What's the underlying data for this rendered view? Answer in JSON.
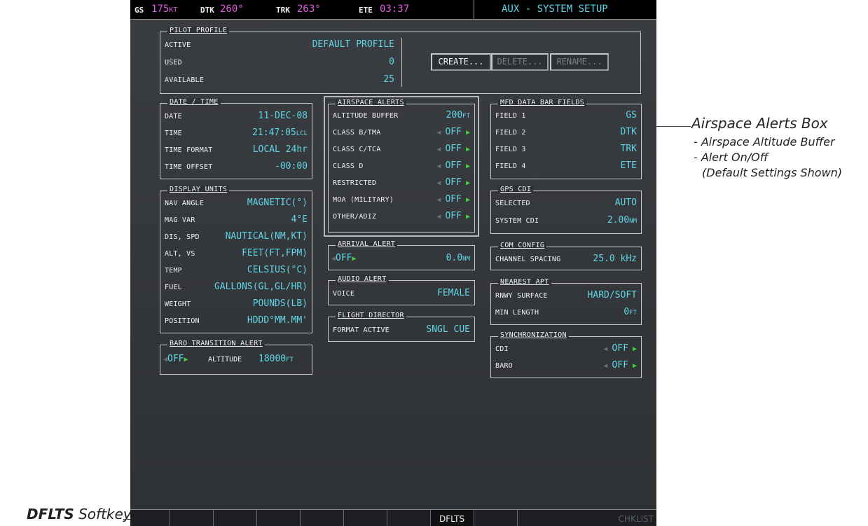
{
  "topbar": {
    "gs_label": "GS",
    "gs_value": "175",
    "gs_unit": "KT",
    "dtk_label": "DTK",
    "dtk_value": "260°",
    "trk_label": "TRK",
    "trk_value": "263°",
    "ete_label": "ETE",
    "ete_value": "03:37",
    "page_title": "AUX - SYSTEM SETUP"
  },
  "pilot_profile": {
    "title": "PILOT PROFILE",
    "active_label": "ACTIVE",
    "active_value": "DEFAULT PROFILE",
    "used_label": "USED",
    "used_value": "0",
    "available_label": "AVAILABLE",
    "available_value": "25",
    "create_label": "CREATE...",
    "delete_label": "DELETE...",
    "rename_label": "RENAME..."
  },
  "date_time": {
    "title": "DATE / TIME",
    "rows": [
      {
        "label": "DATE",
        "value": "11-DEC-08",
        "unit": ""
      },
      {
        "label": "TIME",
        "value": "21:47:05",
        "unit": "LCL"
      },
      {
        "label": "TIME FORMAT",
        "value": "LOCAL 24hr",
        "unit": ""
      },
      {
        "label": "TIME OFFSET",
        "value": "-00:00",
        "unit": ""
      }
    ]
  },
  "display_units": {
    "title": "DISPLAY UNITS",
    "rows": [
      {
        "label": "NAV ANGLE",
        "value": "MAGNETIC(°)"
      },
      {
        "label": "MAG VAR",
        "value": "4°E"
      },
      {
        "label": "DIS, SPD",
        "value": "NAUTICAL(NM,KT)"
      },
      {
        "label": "ALT, VS",
        "value": "FEET(FT,FPM)"
      },
      {
        "label": "TEMP",
        "value": "CELSIUS(°C)"
      },
      {
        "label": "FUEL",
        "value": "GALLONS(GL,GL/HR)"
      },
      {
        "label": "WEIGHT",
        "value": "POUNDS(LB)"
      },
      {
        "label": "POSITION",
        "value": "HDDD°MM.MM'"
      }
    ]
  },
  "baro_alert": {
    "title": "BARO TRANSITION ALERT",
    "state": "OFF",
    "altitude_label": "ALTITUDE",
    "altitude_value": "18000",
    "altitude_unit": "FT"
  },
  "airspace_alerts": {
    "title": "AIRSPACE ALERTS",
    "buffer_label": "ALTITUDE BUFFER",
    "buffer_value": "200",
    "buffer_unit": "FT",
    "rows": [
      {
        "label": "CLASS B/TMA",
        "state": "OFF"
      },
      {
        "label": "CLASS C/TCA",
        "state": "OFF"
      },
      {
        "label": "CLASS D",
        "state": "OFF"
      },
      {
        "label": "RESTRICTED",
        "state": "OFF"
      },
      {
        "label": "MOA (MILITARY)",
        "state": "OFF"
      },
      {
        "label": "OTHER/ADIZ",
        "state": "OFF"
      }
    ]
  },
  "arrival_alert": {
    "title": "ARRIVAL ALERT",
    "state": "OFF",
    "value": "0.0",
    "unit": "NM"
  },
  "audio_alert": {
    "title": "AUDIO ALERT",
    "label": "VOICE",
    "value": "FEMALE"
  },
  "flight_director": {
    "title": "FLIGHT DIRECTOR",
    "label": "FORMAT ACTIVE",
    "value": "SNGL CUE"
  },
  "mfd_data_bar": {
    "title": "MFD DATA BAR FIELDS",
    "rows": [
      {
        "label": "FIELD 1",
        "value": "GS"
      },
      {
        "label": "FIELD 2",
        "value": "DTK"
      },
      {
        "label": "FIELD 3",
        "value": "TRK"
      },
      {
        "label": "FIELD 4",
        "value": "ETE"
      }
    ]
  },
  "gps_cdi": {
    "title": "GPS CDI",
    "selected_label": "SELECTED",
    "selected_value": "AUTO",
    "system_label": "SYSTEM CDI",
    "system_value": "2.00",
    "system_unit": "NM"
  },
  "com_config": {
    "title": "COM CONFIG",
    "label": "CHANNEL SPACING",
    "value": "25.0 kHz"
  },
  "nearest_apt": {
    "title": "NEAREST APT",
    "surface_label": "RNWY SURFACE",
    "surface_value": "HARD/SOFT",
    "length_label": "MIN LENGTH",
    "length_value": "0",
    "length_unit": "FT"
  },
  "synchronization": {
    "title": "SYNCHRONIZATION",
    "rows": [
      {
        "label": "CDI",
        "state": "OFF"
      },
      {
        "label": "BARO",
        "state": "OFF"
      }
    ]
  },
  "softkeys": [
    "",
    "",
    "",
    "",
    "",
    "",
    "",
    "DFLTS",
    "",
    "CHKLIST"
  ],
  "annotations": {
    "airspace_title": "Airspace Alerts Box",
    "airspace_line1": "- Airspace Altitude Buffer",
    "airspace_line2": "- Alert On/Off",
    "airspace_line3": "(Default Settings Shown)",
    "dflts_bold": "DFLTS",
    "dflts_rest": " Softkey"
  }
}
